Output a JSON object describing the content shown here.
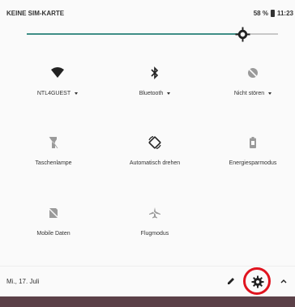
{
  "status_bar": {
    "carrier": "KEINE SIM-KARTE",
    "battery": "58 %",
    "time": "11:23"
  },
  "brightness": {
    "level": 0.8
  },
  "tiles": [
    {
      "label": "NTL4GUEST",
      "icon": "wifi-icon",
      "has_dropdown": true
    },
    {
      "label": "Bluetooth",
      "icon": "bluetooth-icon",
      "has_dropdown": true
    },
    {
      "label": "Nicht stören",
      "icon": "do-not-disturb-off-icon",
      "has_dropdown": true
    },
    {
      "label": "Taschenlampe",
      "icon": "flashlight-off-icon",
      "has_dropdown": false
    },
    {
      "label": "Automatisch drehen",
      "icon": "auto-rotate-icon",
      "has_dropdown": false
    },
    {
      "label": "Energiesparmodus",
      "icon": "battery-saver-icon",
      "has_dropdown": false
    },
    {
      "label": "Mobile Daten",
      "icon": "mobile-data-off-icon",
      "has_dropdown": false
    },
    {
      "label": "Flugmodus",
      "icon": "airplane-mode-icon",
      "has_dropdown": false
    }
  ],
  "footer": {
    "date": "Mi., 17. Juli"
  },
  "colors": {
    "accent": "#3f8e86",
    "highlight": "#e0141f",
    "bottom_strip": "#5b4048"
  }
}
